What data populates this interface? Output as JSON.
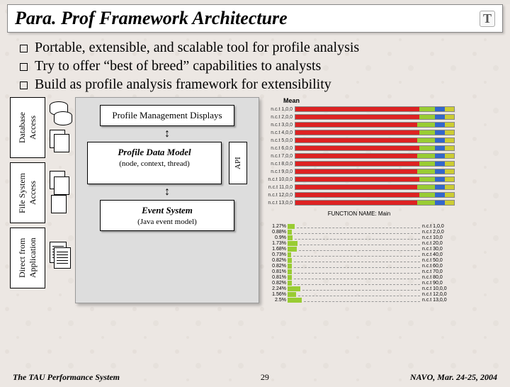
{
  "title": "Para. Prof Framework Architecture",
  "logo_text": "T",
  "bullets": [
    "Portable, extensible, and scalable tool for profile analysis",
    "Try to offer “best of breed” capabilities to analysts",
    "Build as profile analysis framework for extensibility"
  ],
  "diagram": {
    "left_boxes": [
      "Database Access",
      "File System Access",
      "Direct from Application"
    ],
    "main_boxes": {
      "top": "Profile Management Displays",
      "mid_title": "Profile Data Model",
      "mid_sub": "(node, context, thread)",
      "api": "API",
      "bot_title": "Event System",
      "bot_sub": "(Java event model)"
    }
  },
  "chart_data": {
    "type": "bar",
    "title": "Mean",
    "function_name": "FUNCTION NAME: Main",
    "rows": [
      {
        "label": "n.c.t 1,0,0",
        "segs": [
          78,
          10,
          6,
          6
        ]
      },
      {
        "label": "n.c.t 2,0,0",
        "segs": [
          78,
          10,
          6,
          6
        ]
      },
      {
        "label": "n.c.t 3,0,0",
        "segs": [
          77,
          11,
          6,
          6
        ]
      },
      {
        "label": "n.c.t 4,0,0",
        "segs": [
          78,
          10,
          6,
          6
        ]
      },
      {
        "label": "n.c.t 5,0,0",
        "segs": [
          77,
          11,
          6,
          6
        ]
      },
      {
        "label": "n.c.t 6,0,0",
        "segs": [
          78,
          10,
          6,
          6
        ]
      },
      {
        "label": "n.c.t 7,0,0",
        "segs": [
          77,
          11,
          6,
          6
        ]
      },
      {
        "label": "n.c.t 8,0,0",
        "segs": [
          78,
          10,
          6,
          6
        ]
      },
      {
        "label": "n.c.t 9,0,0",
        "segs": [
          77,
          11,
          6,
          6
        ]
      },
      {
        "label": "n.c.t 10,0,0",
        "segs": [
          78,
          10,
          6,
          6
        ]
      },
      {
        "label": "n.c.t 11,0,0",
        "segs": [
          77,
          11,
          6,
          6
        ]
      },
      {
        "label": "n.c.t 12,0,0",
        "segs": [
          78,
          10,
          6,
          6
        ]
      },
      {
        "label": "n.c.t 13,0,0",
        "segs": [
          77,
          11,
          6,
          6
        ]
      }
    ],
    "mini": [
      {
        "pct": "1.27%",
        "w": 10,
        "end": "n.c.t 1,0,0"
      },
      {
        "pct": "0.88%",
        "w": 6,
        "end": "n.c.t 2,0,0"
      },
      {
        "pct": "0.9%",
        "w": 7,
        "end": "n.c.t 10,0"
      },
      {
        "pct": "1.73%",
        "w": 14,
        "end": "n.c.t 20,0"
      },
      {
        "pct": "1.68%",
        "w": 13,
        "end": "n.c.t 30,0"
      },
      {
        "pct": "0.73%",
        "w": 5,
        "end": "n.c.t 40,0"
      },
      {
        "pct": "0.82%",
        "w": 6,
        "end": "n.c.t 50,0"
      },
      {
        "pct": "0.82%",
        "w": 6,
        "end": "n.c.t 60,0"
      },
      {
        "pct": "0.81%",
        "w": 6,
        "end": "n.c.t 70,0"
      },
      {
        "pct": "0.81%",
        "w": 6,
        "end": "n.c.t 80,0"
      },
      {
        "pct": "0.82%",
        "w": 6,
        "end": "n.c.t 90,0"
      },
      {
        "pct": "2.24%",
        "w": 18,
        "end": "n.c.t 10,0,0"
      },
      {
        "pct": "1.56%",
        "w": 12,
        "end": "n.c.t 12,0,0"
      },
      {
        "pct": "2.5%",
        "w": 20,
        "end": "n.c.t 13,0,0"
      }
    ]
  },
  "footer": {
    "left": "The TAU Performance System",
    "page": "29",
    "right": "NAVO, Mar. 24-25, 2004"
  }
}
